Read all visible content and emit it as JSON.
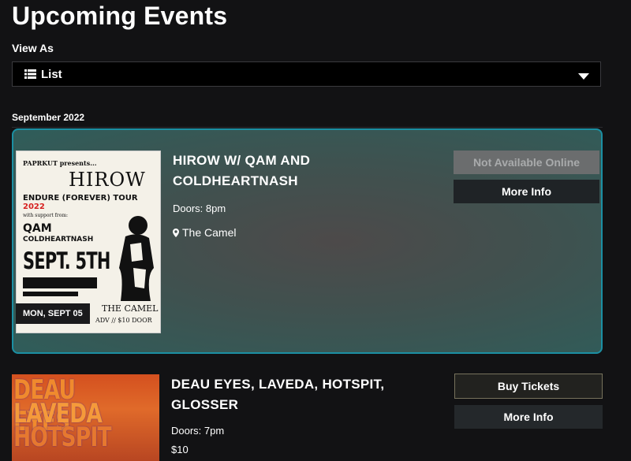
{
  "page": {
    "title": "Upcoming Events"
  },
  "view": {
    "label": "View As",
    "selected": "List",
    "icon": "list-icon"
  },
  "month": "September 2022",
  "events": [
    {
      "title_line1": "HIROW W/ QAM AND",
      "title_line2": "COLDHEARTNASH",
      "doors": "Doors: 8pm",
      "venue": "The Camel",
      "date_badge": "MON, SEPT 05",
      "status_button": "Not Available Online",
      "more_button": "More Info",
      "poster": {
        "presenter": "PAPRKUT presents...",
        "headliner": "HIROW",
        "tour": "ENDURE (FOREVER) TOUR",
        "year": "2022",
        "support_label": "with support from:",
        "support1": "QAM",
        "support2": "COLDHEARTNASH",
        "date": "SEPT. 5TH",
        "venue": "THE CAMEL",
        "price": "ADV // $10 DOOR"
      }
    },
    {
      "title_line1": "DEAU EYES, LAVEDA, HOTSPIT,",
      "title_line2": "GLOSSER",
      "doors": "Doors: 7pm",
      "price_partial": "$10",
      "buy_button": "Buy Tickets",
      "more_button": "More Info",
      "poster": {
        "line1": "DEAU EYES",
        "line2": "LAVEDA",
        "line3": "HOTSPIT"
      }
    }
  ],
  "colors": {
    "accent_border": "#1b8fa3",
    "background": "#121214",
    "tour_year": "#d62020"
  }
}
